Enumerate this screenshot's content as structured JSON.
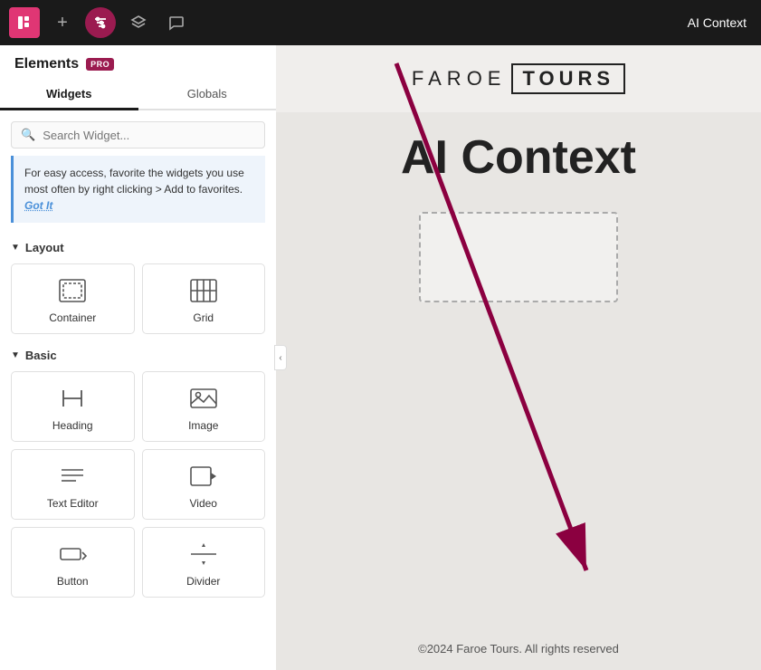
{
  "topbar": {
    "logo_label": "E",
    "add_label": "+",
    "filter_label": "⚙",
    "layers_label": "≡",
    "comments_label": "💬",
    "context_label": "AI Context"
  },
  "sidebar": {
    "title": "Elements",
    "pro_badge": "PRO",
    "tabs": [
      {
        "label": "Widgets",
        "active": true
      },
      {
        "label": "Globals",
        "active": false
      }
    ],
    "search_placeholder": "Search Widget...",
    "hint": {
      "text": "For easy access, favorite the widgets you use most often by right clicking > Add to favorites.",
      "cta": "Got It"
    },
    "layout_section": {
      "label": "Layout",
      "widgets": [
        {
          "id": "container",
          "label": "Container"
        },
        {
          "id": "grid",
          "label": "Grid"
        }
      ]
    },
    "basic_section": {
      "label": "Basic",
      "widgets": [
        {
          "id": "heading",
          "label": "Heading"
        },
        {
          "id": "image",
          "label": "Image"
        },
        {
          "id": "text-editor",
          "label": "Text Editor"
        },
        {
          "id": "video",
          "label": "Video"
        },
        {
          "id": "button",
          "label": "Button"
        },
        {
          "id": "divider",
          "label": "Divider"
        }
      ]
    }
  },
  "canvas": {
    "site_name_part1": "FAROE",
    "site_name_part2": "TOURS",
    "page_title": "AI Context",
    "footer_text": "©2024 Faroe Tours. All rights reserved"
  }
}
